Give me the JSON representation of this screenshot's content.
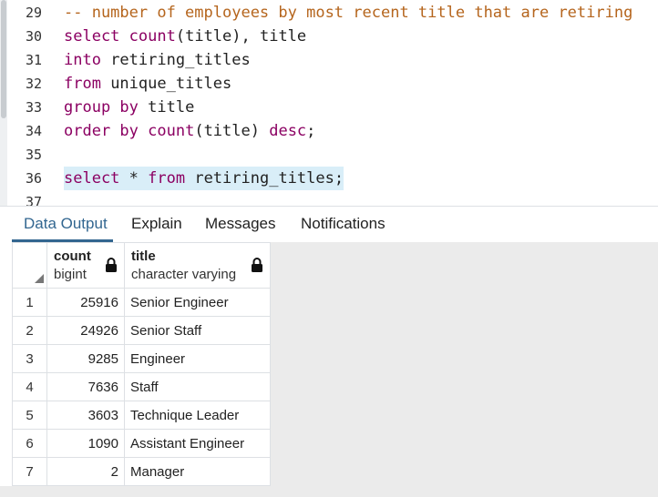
{
  "editor": {
    "lines": [
      {
        "num": "29",
        "tokens": [
          {
            "t": "-- number of employees by most recent title that are retiring",
            "c": "cm"
          }
        ]
      },
      {
        "num": "30",
        "tokens": [
          {
            "t": "select",
            "c": "kw"
          },
          {
            "t": " ",
            "c": "pn"
          },
          {
            "t": "count",
            "c": "kw"
          },
          {
            "t": "(title), title",
            "c": "pn"
          }
        ]
      },
      {
        "num": "31",
        "tokens": [
          {
            "t": "into",
            "c": "kw"
          },
          {
            "t": " retiring_titles",
            "c": "pn"
          }
        ]
      },
      {
        "num": "32",
        "tokens": [
          {
            "t": "from",
            "c": "kw"
          },
          {
            "t": " unique_titles",
            "c": "pn"
          }
        ]
      },
      {
        "num": "33",
        "tokens": [
          {
            "t": "group by",
            "c": "kw"
          },
          {
            "t": " title",
            "c": "pn"
          }
        ]
      },
      {
        "num": "34",
        "tokens": [
          {
            "t": "order by",
            "c": "kw"
          },
          {
            "t": " ",
            "c": "pn"
          },
          {
            "t": "count",
            "c": "kw"
          },
          {
            "t": "(title) ",
            "c": "pn"
          },
          {
            "t": "desc",
            "c": "kw"
          },
          {
            "t": ";",
            "c": "pn"
          }
        ]
      },
      {
        "num": "35",
        "tokens": []
      },
      {
        "num": "36",
        "highlight": true,
        "tokens": [
          {
            "t": "select",
            "c": "kw"
          },
          {
            "t": " * ",
            "c": "pn"
          },
          {
            "t": "from",
            "c": "kw"
          },
          {
            "t": " retiring_titles;",
            "c": "pn"
          }
        ]
      },
      {
        "num": "37",
        "tokens": []
      }
    ]
  },
  "tabs": {
    "data_output": "Data Output",
    "explain": "Explain",
    "messages": "Messages",
    "notifications": "Notifications"
  },
  "grid": {
    "columns": [
      {
        "name": "count",
        "type": "bigint"
      },
      {
        "name": "title",
        "type": "character varying"
      }
    ],
    "rows": [
      {
        "n": "1",
        "count": "25916",
        "title": "Senior Engineer"
      },
      {
        "n": "2",
        "count": "24926",
        "title": "Senior Staff"
      },
      {
        "n": "3",
        "count": "9285",
        "title": "Engineer"
      },
      {
        "n": "4",
        "count": "7636",
        "title": "Staff"
      },
      {
        "n": "5",
        "count": "3603",
        "title": "Technique Leader"
      },
      {
        "n": "6",
        "count": "1090",
        "title": "Assistant Engineer"
      },
      {
        "n": "7",
        "count": "2",
        "title": "Manager"
      }
    ]
  },
  "colors": {
    "keyword": "#8b0062",
    "comment": "#b5651d",
    "active_tab": "#326690",
    "line_highlight": "#d9eef8"
  }
}
